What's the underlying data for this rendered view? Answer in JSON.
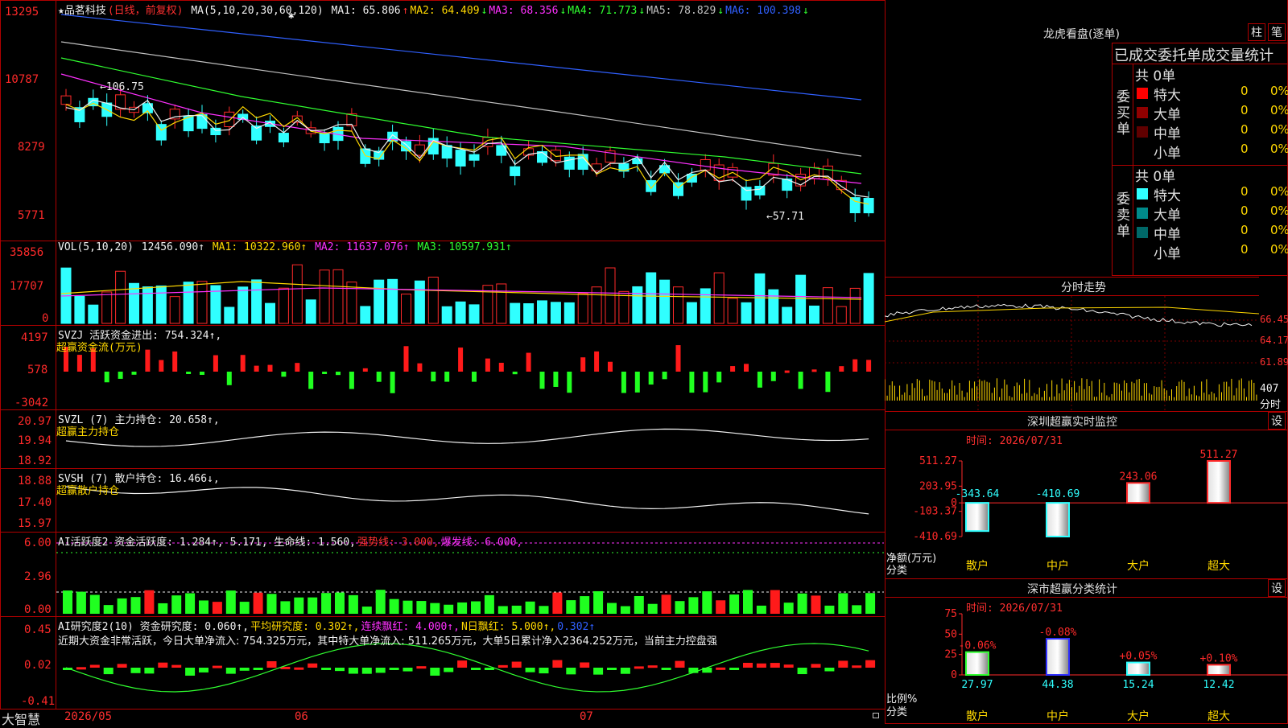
{
  "stock": {
    "name": "★品茗科技",
    "mode": "(日线，前复权)"
  },
  "ma_header": {
    "label": "MA(5,10,20,30,60,120)",
    "items": [
      {
        "text": "MA1: 65.806",
        "arrow": "↑",
        "color": "#f0f0f0"
      },
      {
        "text": "MA2: 64.409",
        "arrow": "↓",
        "color": "#ffd800"
      },
      {
        "text": "MA3: 68.356",
        "arrow": "↓",
        "color": "#ff30ff"
      },
      {
        "text": "MA4: 71.773",
        "arrow": "↓",
        "color": "#30ff30"
      },
      {
        "text": "MA5: 78.829",
        "arrow": "↓",
        "color": "#c0c0c0"
      },
      {
        "text": "MA6: 100.398",
        "arrow": "↓",
        "color": "#3060ff"
      }
    ]
  },
  "price_axis": [
    "13295",
    "10787",
    "8279",
    "5771"
  ],
  "price_annotations": {
    "high": "←106.75",
    "low": "←57.71"
  },
  "vol_header": {
    "label": "VOL(5,10,20)",
    "value": "12456.090↑",
    "ma1": "MA1: 10322.960↑",
    "ma2": "MA2: 11637.076↑",
    "ma3": "MA3: 10597.931↑"
  },
  "vol_axis": [
    "35856",
    "17707",
    "0"
  ],
  "svzj": {
    "label": "SVZJ  活跃资金进出: 754.324↑,",
    "sub": "超赢资金流(万元)",
    "axis": [
      "4197",
      "578",
      "-3042"
    ]
  },
  "svzl": {
    "label": "SVZL (7) 主力持仓: 20.658↑,",
    "sub": "超赢主力持仓",
    "axis": [
      "20.97",
      "19.94",
      "18.92"
    ]
  },
  "svsh": {
    "label": "SVSH (7) 散户持仓: 16.466↓,",
    "sub": "超赢散户持仓",
    "axis": [
      "18.88",
      "17.40",
      "15.97"
    ]
  },
  "ai_active": {
    "label": "AI活跃度2 资金活跃度: 1.284↑, 5.171, 生命线: 1.560,",
    "strong": "强势线: 3.000,",
    "burst": "爆发线: 6.000,",
    "axis": [
      "6.00",
      "2.96",
      "0.00"
    ]
  },
  "ai_research": {
    "label": "AI研究度2(10) 资金研究度: 0.060↑,",
    "avg": "平均研究度: 0.302↑,",
    "cont": "连续飘红: 4.000↑,",
    "nday": "N日飘红: 5.000↑,",
    "last": "0.302↑",
    "summary": "近期大资金非常活跃，今日大单净流入: 754.325万元，其中特大单净流入: 511.265万元，大单5日累计净入2364.252万元，当前主力控盘强",
    "axis": [
      "0.45",
      "0.02",
      "-0.41"
    ]
  },
  "date_axis": [
    "2026/05",
    "06",
    "07"
  ],
  "brand": "大智慧",
  "right_panel": {
    "lhb_title": "龙虎看盘(逐单)",
    "btn_column": "柱",
    "btn_detail": "笔",
    "stats_title": "已成交委托单成交量统计",
    "buy_label": "委买单",
    "sell_label": "委卖单",
    "buy_total": "共 0单",
    "sell_total": "共 0单",
    "buy_rows": [
      {
        "name": "特大",
        "count": "0",
        "pct": "0%",
        "color": "#ff0000"
      },
      {
        "name": "大单",
        "count": "0",
        "pct": "0%",
        "color": "#900000"
      },
      {
        "name": "中单",
        "count": "0",
        "pct": "0%",
        "color": "#600000"
      },
      {
        "name": "小单",
        "count": "0",
        "pct": "0%",
        "color": "#000000"
      }
    ],
    "sell_rows": [
      {
        "name": "特大",
        "count": "0",
        "pct": "0%",
        "color": "#30ffff"
      },
      {
        "name": "大单",
        "count": "0",
        "pct": "0%",
        "color": "#008a8a"
      },
      {
        "name": "中单",
        "count": "0",
        "pct": "0%",
        "color": "#006868"
      },
      {
        "name": "小单",
        "count": "0",
        "pct": "0%",
        "color": "#000000"
      }
    ],
    "intraday_title": "分时走势",
    "intraday_axis": [
      "66.45",
      "64.17",
      "61.89",
      "407",
      "分时"
    ],
    "sz_monitor_title": "深圳超赢实时监控",
    "sz_monitor_date": "时间: 2026/07/31",
    "sz_monitor_axis": [
      "511.27",
      "203.95",
      "0",
      "-103.37",
      "-410.69"
    ],
    "sz_monitor_ylabel": "净额(万元)",
    "sz_monitor_xlabel": "分类",
    "set_label": "设",
    "sz_class_title": "深市超赢分类统计",
    "sz_class_date": "时间: 2026/07/31",
    "sz_class_axis": [
      "75",
      "50",
      "25",
      "0"
    ],
    "sz_class_ylabel": "比例%",
    "sz_class_xlabel": "分类"
  },
  "chart_data": [
    {
      "type": "bar",
      "title": "深圳超赢实时监控",
      "categories": [
        "散户",
        "中户",
        "大户",
        "超大"
      ],
      "values": [
        -343.64,
        -410.69,
        243.06,
        511.27
      ],
      "value_labels": [
        "-343.64",
        "-410.69",
        "243.06",
        "511.27"
      ],
      "ylabel": "净额(万元)",
      "xlabel": "分类",
      "ylim": [
        -410.69,
        511.27
      ]
    },
    {
      "type": "bar",
      "title": "深市超赢分类统计",
      "categories": [
        "散户",
        "中户",
        "大户",
        "超大"
      ],
      "values": [
        27.97,
        44.38,
        15.24,
        12.42
      ],
      "value_labels": [
        "27.97",
        "44.38",
        "15.24",
        "12.42"
      ],
      "changes": [
        "-0.06%",
        "-0.08%",
        "+0.05%",
        "+0.10%"
      ],
      "ylabel": "比例%",
      "xlabel": "分类",
      "ylim": [
        0,
        75
      ]
    }
  ]
}
